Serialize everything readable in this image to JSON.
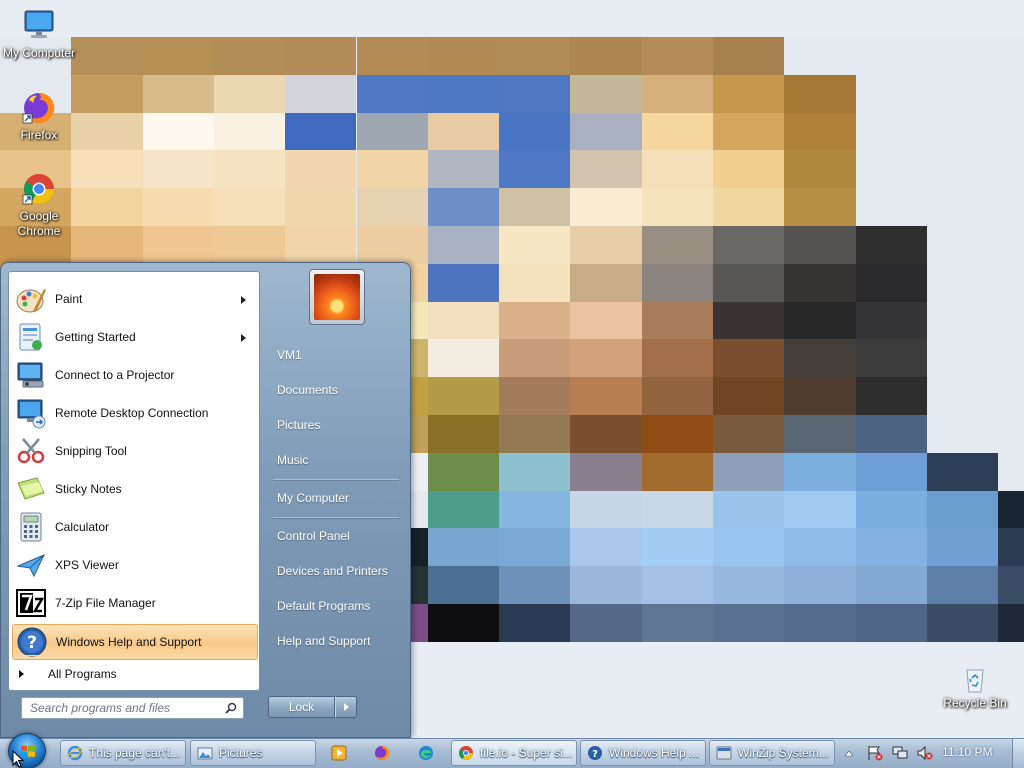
{
  "desktop": {
    "icons": {
      "my_computer": "My Computer",
      "firefox": "Firefox",
      "chrome_line1": "Google",
      "chrome_line2": "Chrome",
      "recycle_bin": "Recycle Bin"
    }
  },
  "start_menu": {
    "pinned": [
      {
        "label": "Paint",
        "icon": "paint-icon",
        "submenu": true
      },
      {
        "label": "Getting Started",
        "icon": "getting-started-icon",
        "submenu": true
      },
      {
        "label": "Connect to a Projector",
        "icon": "projector-icon",
        "submenu": false
      },
      {
        "label": "Remote Desktop Connection",
        "icon": "remote-desktop-icon",
        "submenu": false
      },
      {
        "label": "Snipping Tool",
        "icon": "snipping-tool-icon",
        "submenu": false
      },
      {
        "label": "Sticky Notes",
        "icon": "sticky-notes-icon",
        "submenu": false
      },
      {
        "label": "Calculator",
        "icon": "calculator-icon",
        "submenu": false
      },
      {
        "label": "XPS Viewer",
        "icon": "xps-viewer-icon",
        "submenu": false
      },
      {
        "label": "7-Zip File Manager",
        "icon": "7zip-icon",
        "submenu": false
      },
      {
        "label": "Windows Help and Support",
        "icon": "help-icon",
        "submenu": false,
        "highlighted": true
      }
    ],
    "all_programs": "All Programs",
    "search_placeholder": "Search programs and files",
    "right": {
      "user": "VM1",
      "documents": "Documents",
      "pictures": "Pictures",
      "music": "Music",
      "my_computer": "My Computer",
      "control_panel": "Control Panel",
      "devices_printers": "Devices and Printers",
      "default_programs": "Default Programs",
      "help_support": "Help and Support"
    },
    "lock_label": "Lock"
  },
  "taskbar": {
    "buttons": [
      {
        "label": "This page can't...",
        "icon": "internet-explorer-icon"
      },
      {
        "label": "Pictures",
        "icon": "pictures-folder-icon"
      },
      {
        "label": "file.io - Super si...",
        "icon": "chrome-icon"
      },
      {
        "label": "Windows Help ...",
        "icon": "help-icon"
      },
      {
        "label": "WinZip System...",
        "icon": "winzip-icon"
      }
    ],
    "clock": "11:10 PM"
  },
  "colors": {
    "highlight": "#f8c98a",
    "start_menu_blue": "#7f9bb7",
    "taskbar": "#a9bed5"
  }
}
